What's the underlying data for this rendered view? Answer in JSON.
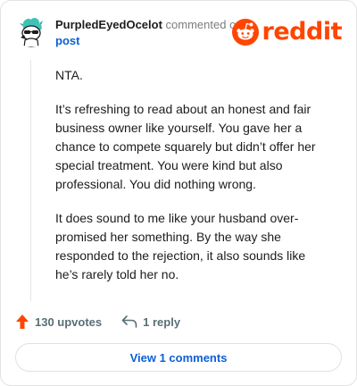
{
  "header": {
    "username": "PurpledEyedOcelot",
    "commented_on": "commented on",
    "post_link": "post",
    "brand_word": "reddit",
    "brand_color": "#ff4500"
  },
  "comment": {
    "paragraphs": [
      "NTA.",
      "It’s refreshing to read about an honest and fair business owner like yourself. You gave her a chance to compete squarely but didn’t offer her special treatment. You were kind but also professional. You did nothing wrong.",
      "It does sound to me like your husband over-promised her something. By the way she responded to the rejection, it also sounds like he’s rarely told her no."
    ]
  },
  "actions": {
    "upvotes_label": "130 upvotes",
    "reply_label": "1 reply",
    "upvote_icon": "upvote-arrow-icon",
    "reply_icon": "reply-arrow-icon"
  },
  "view_comments_label": "View 1 comments"
}
